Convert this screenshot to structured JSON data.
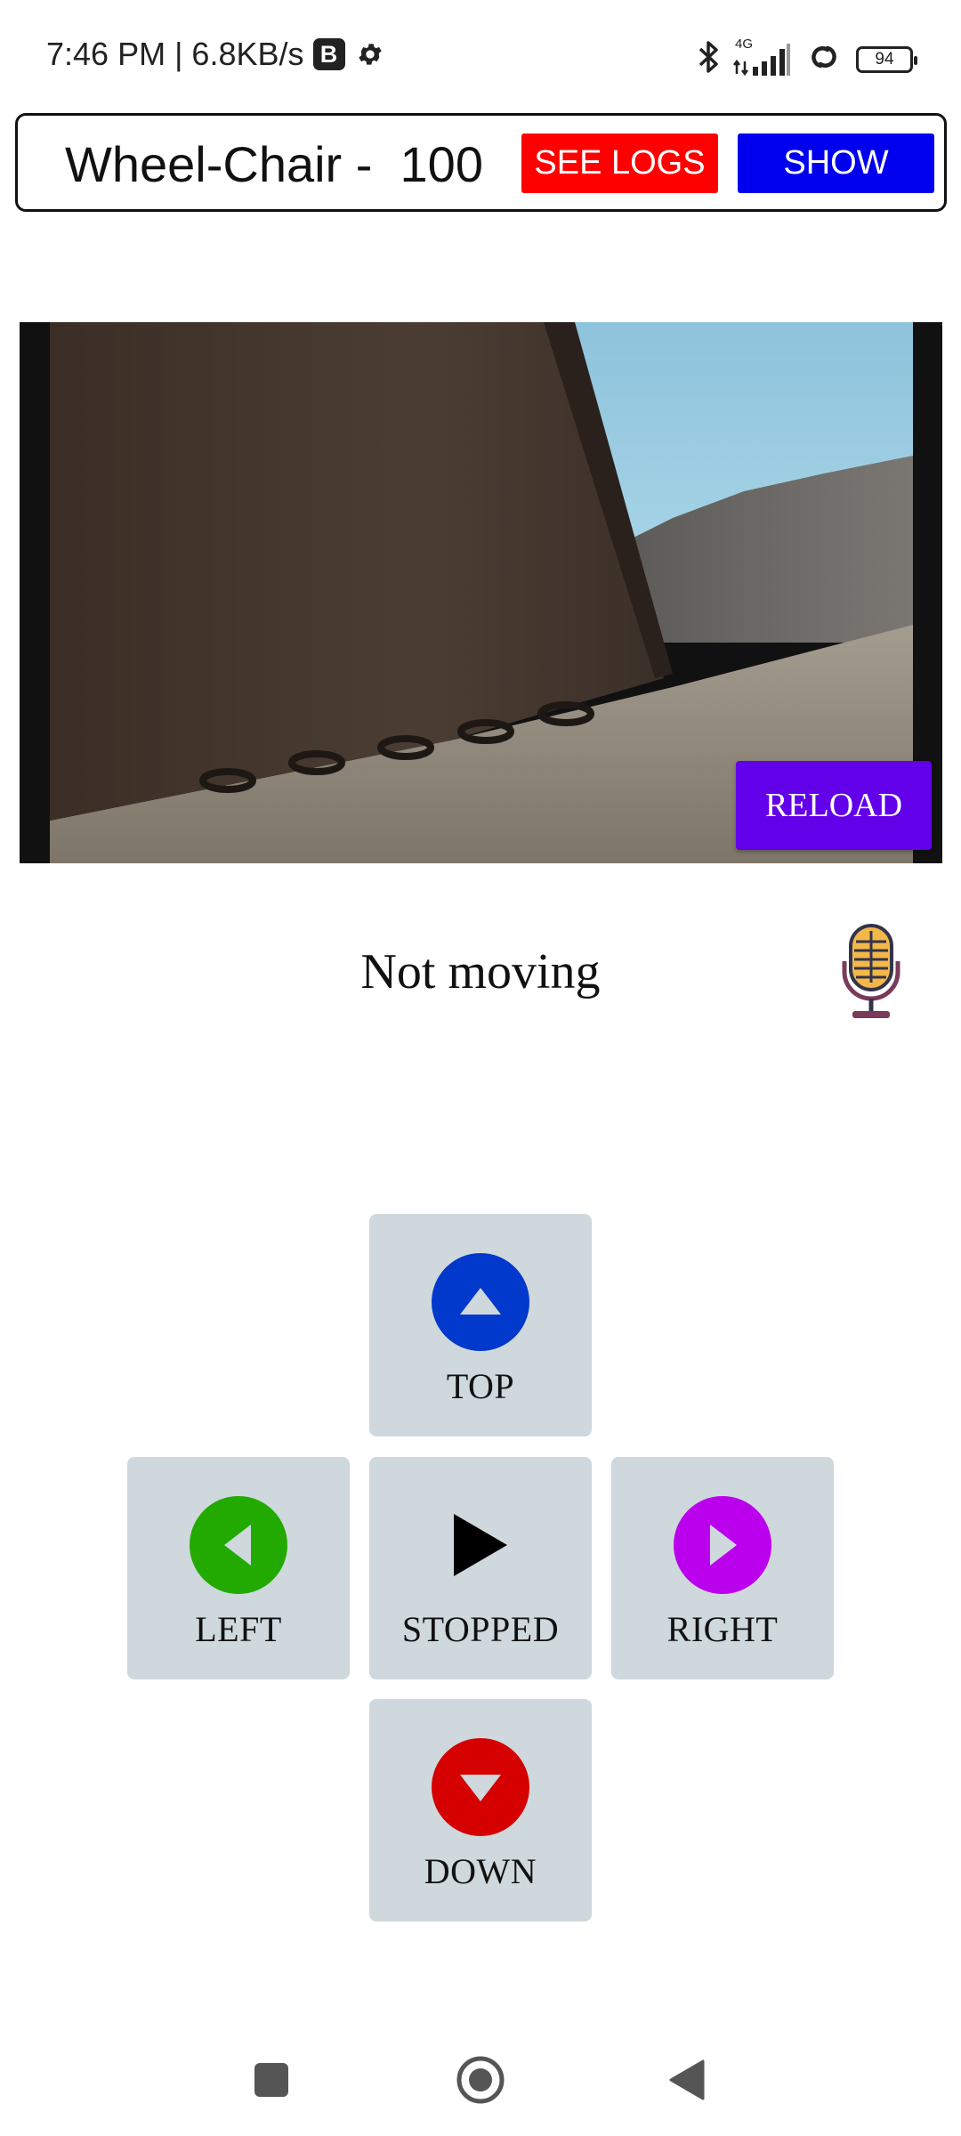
{
  "status_bar": {
    "time": "7:46 PM | 6.8KB/s",
    "b_badge": "B",
    "icons": [
      "gear-icon",
      "bluetooth-icon",
      "signal-icon",
      "link-icon",
      "battery-icon"
    ],
    "network_label": "4G",
    "battery": "94"
  },
  "header": {
    "title": "Wheel-Chair -  100",
    "see_logs_label": "SEE LOGS",
    "show_label": "SHOW",
    "colors": {
      "see_logs": "#ff0000",
      "show": "#0000ee"
    }
  },
  "camera": {
    "reload_label": "RELOAD",
    "reload_color": "#6200ea"
  },
  "movement": {
    "status_text": "Not moving",
    "mic_icon": "microphone-icon"
  },
  "controls": {
    "top": {
      "label": "TOP",
      "icon": "arrow-up-icon",
      "color": "#0039cb"
    },
    "left": {
      "label": "LEFT",
      "icon": "arrow-left-icon",
      "color": "#22aa00"
    },
    "stop": {
      "label": "STOPPED",
      "icon": "play-icon",
      "color": "#000000"
    },
    "right": {
      "label": "RIGHT",
      "icon": "arrow-right-icon",
      "color": "#bb00ee"
    },
    "down": {
      "label": "DOWN",
      "icon": "arrow-down-icon",
      "color": "#d50000"
    }
  },
  "nav_bar": {
    "icons": [
      "recents-icon",
      "home-icon",
      "back-icon"
    ]
  }
}
